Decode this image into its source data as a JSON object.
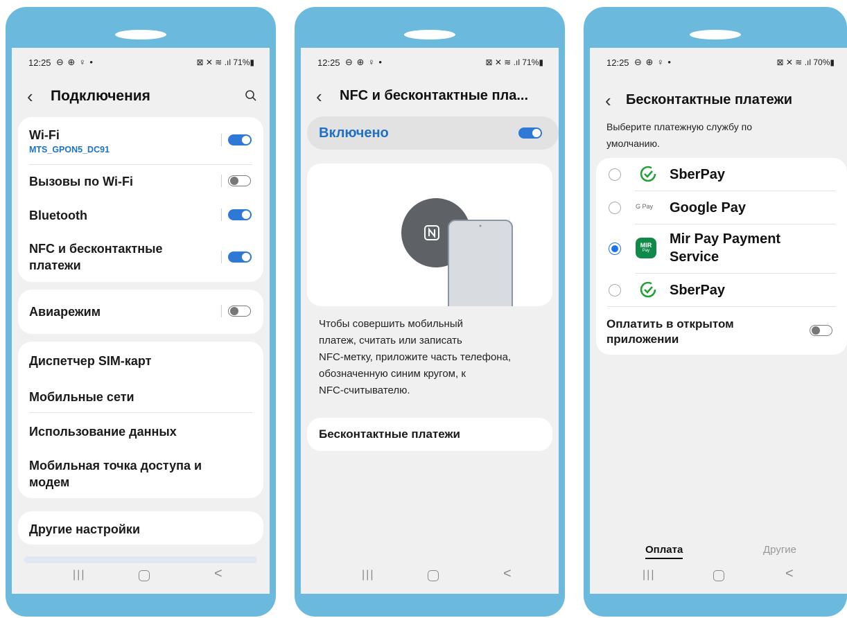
{
  "status1": {
    "time": "12:25",
    "left_icons": "⊖ ⊕ ♀ •",
    "right": "⊠ ✕ ≋ .ıl 71%▮"
  },
  "status2": {
    "time": "12:25",
    "left_icons": "⊖ ⊕ ♀ •",
    "right": "⊠ ✕ ≋ .ıl 71%▮"
  },
  "status3": {
    "time": "12:25",
    "left_icons": "⊖ ⊕ ♀ •",
    "right": "⊠ ✕ ≋ .ıl 70%▮"
  },
  "screen1": {
    "title": "Подключения",
    "wifi": {
      "label": "Wi-Fi",
      "network": "MTS_GPON5_DC91"
    },
    "wifi_calls": "Вызовы по Wi-Fi",
    "bluetooth": "Bluetooth",
    "nfc": {
      "line1": "NFC и бесконтактные",
      "line2": "платежи"
    },
    "airplane": "Авиарежим",
    "sim_manager": "Диспетчер SIM-карт",
    "mobile_networks": "Мобильные сети",
    "data_usage": "Использование данных",
    "hotspot": {
      "line1": "Мобильная точка доступа и",
      "line2": "модем"
    },
    "other_settings": "Другие настройки"
  },
  "screen2": {
    "title": "NFC и бесконтактные пла...",
    "enabled_label": "Включено",
    "description": [
      "Чтобы совершить мобильный",
      "платеж, считать или записать",
      "NFC-метку, приложите часть телефона,",
      "обозначенную синим кругом, к",
      "NFC-считывателю."
    ],
    "contactless_payments": "Бесконтактные платежи"
  },
  "screen3": {
    "title": "Бесконтактные платежи",
    "subtitle": [
      "Выберите платежную службу по",
      "умолчанию."
    ],
    "services": [
      {
        "name": "SberPay"
      },
      {
        "name": "Google Pay",
        "icon_text": "G Pay"
      },
      {
        "name_line1": "Mir Pay Payment",
        "name_line2": "Service",
        "icon_text": "MIR",
        "icon_sub": "Pay"
      },
      {
        "name": "SberPay"
      }
    ],
    "pay_in_open_app": {
      "line1": "Оплатить в открытом",
      "line2": "приложении"
    },
    "tab_payment": "Оплата",
    "tab_other": "Другие"
  },
  "colors": {
    "accent": "#2e78d6",
    "frame": "#6bbade",
    "sber_green": "#21a038",
    "mir_green": "#0f8a4a"
  },
  "nav": {
    "recent": "|||",
    "back": "<"
  }
}
